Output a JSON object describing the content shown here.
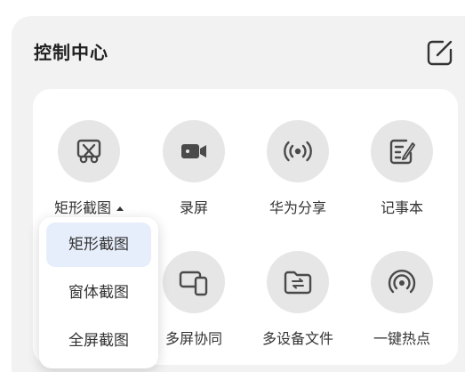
{
  "panel": {
    "title": "控制中心",
    "edit_icon": "edit-icon"
  },
  "tiles": [
    {
      "label": "矩形截图",
      "icon": "screenshot-scissors-icon"
    },
    {
      "label": "录屏",
      "icon": "video-camera-icon"
    },
    {
      "label": "华为分享",
      "icon": "share-wireless-icon"
    },
    {
      "label": "记事本",
      "icon": "notepad-icon"
    },
    {
      "label": "多屏协同",
      "icon": "multi-screen-icon"
    },
    {
      "label": "多设备文件",
      "icon": "folder-transfer-icon"
    },
    {
      "label": "一键热点",
      "icon": "hotspot-icon"
    }
  ],
  "screenshot_menu": {
    "items": [
      "矩形截图",
      "窗体截图",
      "全屏截图"
    ],
    "selected": "矩形截图"
  },
  "colors": {
    "panel_bg": "#f2f2f2",
    "card_bg": "#ffffff",
    "icon_circle": "#e6e6e6",
    "icon_color": "#4a4a4a",
    "selected_bg": "#e7eefb"
  }
}
